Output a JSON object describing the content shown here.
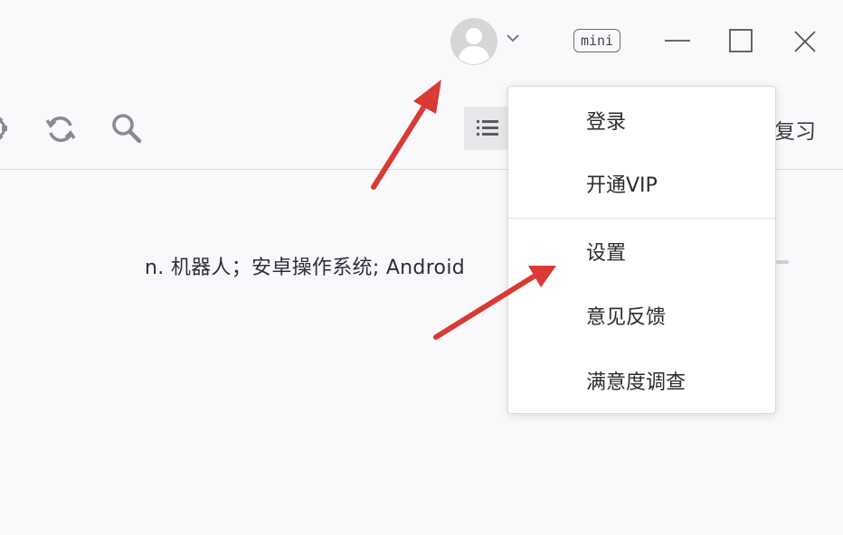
{
  "titlebar": {
    "avatar_icon": "user-avatar-icon",
    "caret_icon": "chevron-down-icon",
    "mini_label": "mini",
    "minimize_icon": "minimize-icon",
    "maximize_icon": "maximize-icon",
    "close_icon": "close-icon"
  },
  "toolbar": {
    "icons": [
      "gear-icon",
      "refresh-icon",
      "search-icon",
      "list-icon"
    ],
    "review_label": "复习"
  },
  "main": {
    "definition": "n. 机器人；安卓操作系统; Android"
  },
  "menu": {
    "items": [
      {
        "label": "登录"
      },
      {
        "label": "开通VIP"
      },
      {
        "label": "设置"
      },
      {
        "label": "意见反馈"
      },
      {
        "label": "满意度调查"
      }
    ]
  },
  "colors": {
    "annotation_arrow": "#d93a34",
    "background": "#f9f9fb",
    "menu_background": "#ffffff"
  }
}
